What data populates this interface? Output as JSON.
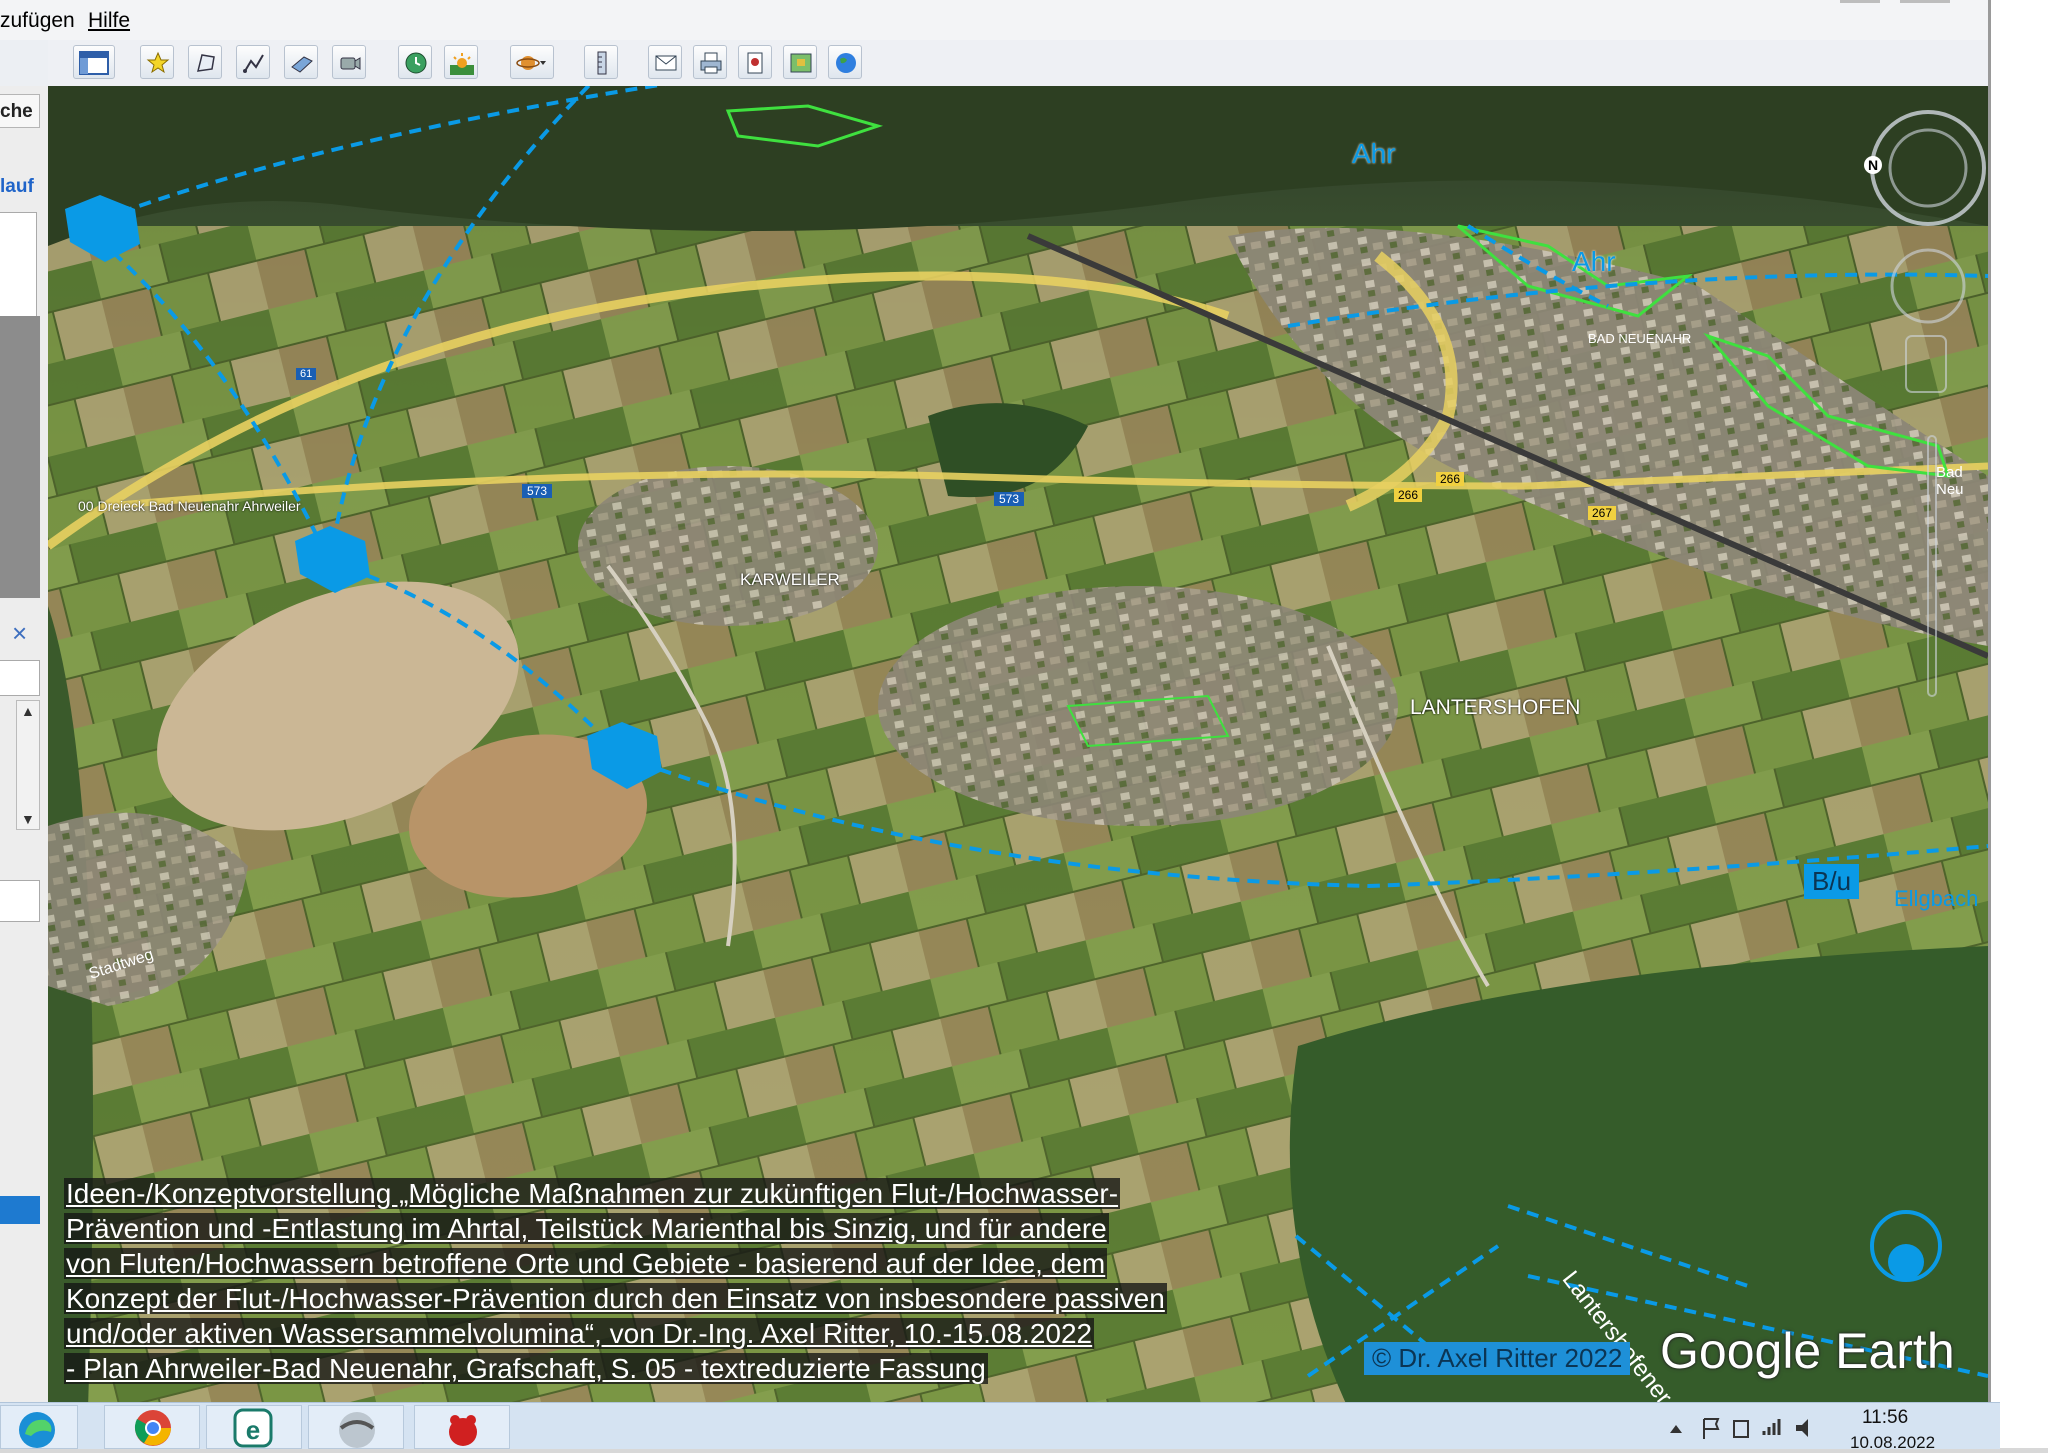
{
  "menu": {
    "add": "zufügen",
    "help": "Hilfe"
  },
  "side": {
    "button": "che",
    "link": "lauf",
    "close": "×"
  },
  "toolbar": {
    "icons": [
      "sidebar-toggle-icon",
      "add-placemark-icon",
      "add-polygon-icon",
      "add-path-icon",
      "add-image-overlay-icon",
      "record-tour-icon",
      "historical-imagery-icon",
      "sunlight-icon",
      "planet-icon",
      "ruler-icon",
      "email-icon",
      "print-icon",
      "save-image-icon",
      "view-in-maps-icon",
      "earth-icon"
    ]
  },
  "map": {
    "labels": {
      "ahr1": "Ahr",
      "ahr2": "Ahr",
      "bad_neuenahr": "BAD NEUENAHR",
      "bad_neu": "Bad Neu",
      "dreieck": "00 Dreieck Bad Neuenahr Ahrweiler",
      "karweiler": "KARWEILER",
      "lantershofen": "LANTERSHOFEN",
      "bu": "B/u",
      "ellgbach": "Ellgbach",
      "lantershofener": "Lantershofener",
      "stadtweg": "Stadtweg",
      "n": "N",
      "r61": "61",
      "r573a": "573",
      "r573b": "573",
      "r266a": "266",
      "r266b": "266",
      "r267": "267"
    },
    "caption": [
      "Ideen-/Konzeptvorstellung „Mögliche Maßnahmen zur zukünftigen Flut-/Hochwasser-",
      "Prävention und -Entlastung im Ahrtal, Teilstück Marienthal bis Sinzig, und für andere",
      "von Fluten/Hochwassern betroffene Orte und Gebiete - basierend auf der Idee, dem",
      "Konzept der Flut-/Hochwasser-Prävention durch den Einsatz von insbesondere passiven",
      "und/oder aktiven Wassersammelvolumina“, von Dr.-Ing. Axel Ritter, 10.-15.08.2022",
      "- Plan Ahrweiler-Bad Neuenahr, Grafschaft, S. 05 - textreduzierte Fassung"
    ],
    "copyright": "© Dr. Axel Ritter 2022",
    "logo": "Google Earth"
  },
  "taskbar": {
    "time": "11:56",
    "date": "10.08.2022"
  },
  "colors": {
    "marker": "#0a9ae6",
    "highlight": "#3fe03f",
    "road": "#e8d060"
  }
}
